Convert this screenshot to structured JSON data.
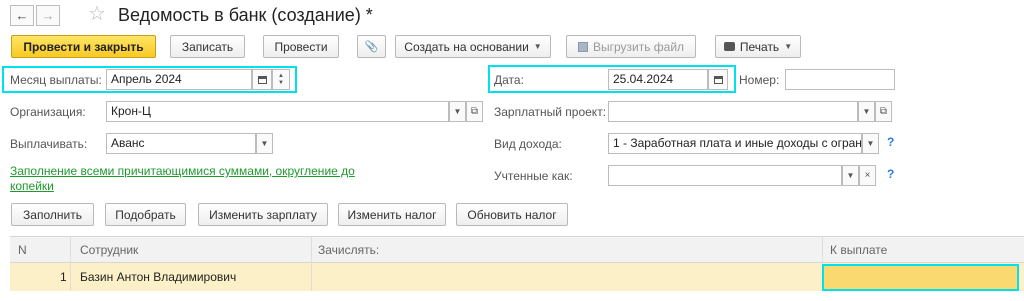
{
  "nav": {
    "back_glyph": "←",
    "forward_glyph": "→",
    "star_icon": "☆"
  },
  "header": {
    "title": "Ведомость в банк (создание) *"
  },
  "toolbar": {
    "post_and_close": "Провести и закрыть",
    "save": "Записать",
    "post": "Провести",
    "attach_icon": "📎",
    "create_based_on": "Создать на основании",
    "export_file": "Выгрузить файл",
    "print": "Печать"
  },
  "form": {
    "month_label": "Месяц выплаты:",
    "month_value": "Апрель 2024",
    "date_label": "Дата:",
    "date_value": "25.04.2024",
    "number_label": "Номер:",
    "number_value": "",
    "org_label": "Организация:",
    "org_value": "Крон-Ц",
    "salary_project_label": "Зарплатный проект:",
    "salary_project_value": "",
    "pay_label": "Выплачивать:",
    "pay_value": "Аванс",
    "income_type_label": "Вид дохода:",
    "income_type_value": "1 - Заработная плата и иные доходы с огран",
    "accounted_label": "Учтенные как:",
    "accounted_value": "",
    "fill_link_line1": "Заполнение всеми причитающимися суммами, округление до",
    "fill_link_line2": "копейки",
    "help_glyph": "?"
  },
  "actions": {
    "fill": "Заполнить",
    "select": "Подобрать",
    "change_salary": "Изменить зарплату",
    "change_tax": "Изменить налог",
    "update_tax": "Обновить налог"
  },
  "table": {
    "columns": [
      "N",
      "Сотрудник",
      "Зачислять:",
      "К выплате"
    ],
    "rows": [
      {
        "n": "1",
        "employee": "Базин Антон Владимирович",
        "credit": "",
        "to_pay": ""
      }
    ]
  },
  "colors": {
    "primary_button": "#f7c924",
    "highlight": "#00e1f0",
    "selected_row": "#fbf0c8",
    "link": "#1f9a2f"
  }
}
